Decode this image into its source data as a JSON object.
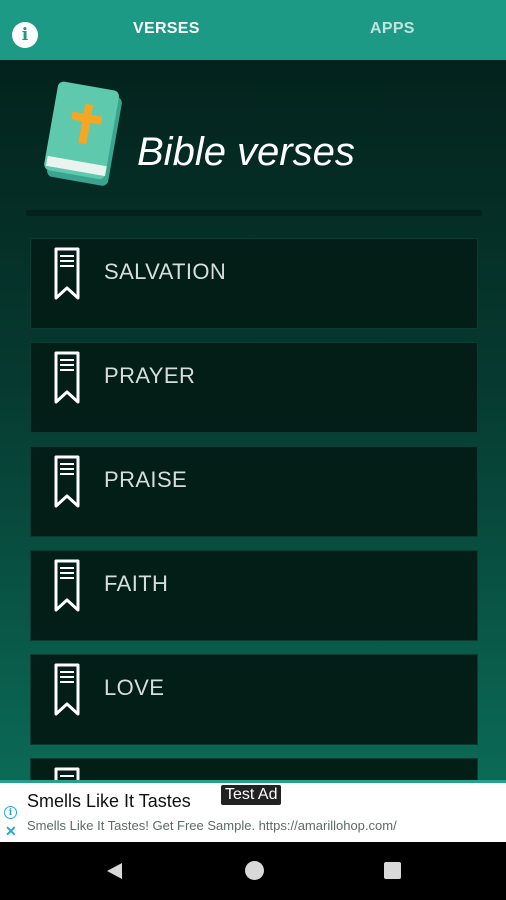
{
  "tabs": {
    "verses": "VERSES",
    "apps": "APPS"
  },
  "header": {
    "title": "Bible verses"
  },
  "topics": [
    "SALVATION",
    "PRAYER",
    "PRAISE",
    "FAITH",
    "LOVE",
    ""
  ],
  "ad": {
    "title": "Smells Like It Tastes",
    "badge": "Test Ad",
    "subtitle": "Smells Like It Tastes! Get Free Sample. https://amarillohop.com/"
  },
  "colors": {
    "toolbar": "#1d9a85",
    "accent": "#26a08a"
  },
  "icons": {
    "info": "info-icon",
    "book": "bible-book-icon",
    "bookmark": "bookmark-icon",
    "back": "back-icon",
    "home": "home-icon",
    "recents": "recents-icon"
  }
}
